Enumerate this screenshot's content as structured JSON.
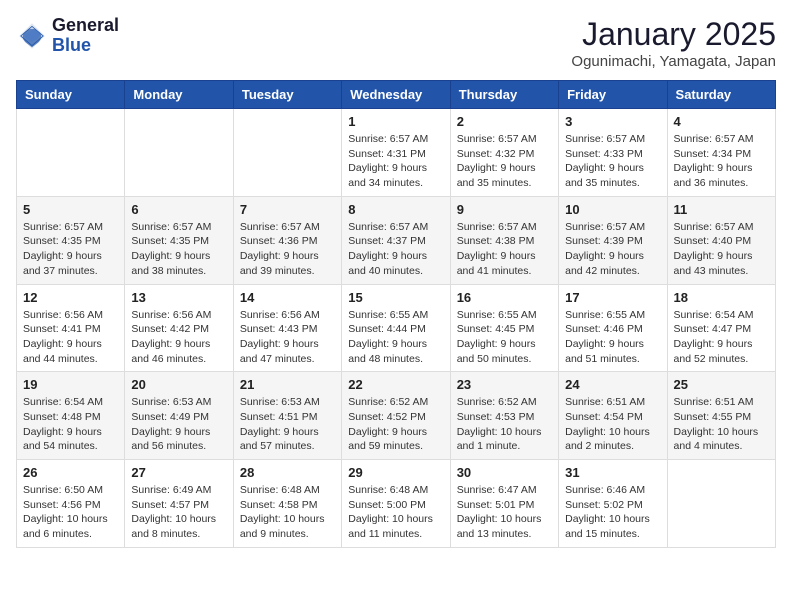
{
  "header": {
    "logo_general": "General",
    "logo_blue": "Blue",
    "month_title": "January 2025",
    "location": "Ogunimachi, Yamagata, Japan"
  },
  "weekdays": [
    "Sunday",
    "Monday",
    "Tuesday",
    "Wednesday",
    "Thursday",
    "Friday",
    "Saturday"
  ],
  "weeks": [
    [
      {
        "day": "",
        "sunrise": "",
        "sunset": "",
        "daylight": ""
      },
      {
        "day": "",
        "sunrise": "",
        "sunset": "",
        "daylight": ""
      },
      {
        "day": "",
        "sunrise": "",
        "sunset": "",
        "daylight": ""
      },
      {
        "day": "1",
        "sunrise": "Sunrise: 6:57 AM",
        "sunset": "Sunset: 4:31 PM",
        "daylight": "Daylight: 9 hours and 34 minutes."
      },
      {
        "day": "2",
        "sunrise": "Sunrise: 6:57 AM",
        "sunset": "Sunset: 4:32 PM",
        "daylight": "Daylight: 9 hours and 35 minutes."
      },
      {
        "day": "3",
        "sunrise": "Sunrise: 6:57 AM",
        "sunset": "Sunset: 4:33 PM",
        "daylight": "Daylight: 9 hours and 35 minutes."
      },
      {
        "day": "4",
        "sunrise": "Sunrise: 6:57 AM",
        "sunset": "Sunset: 4:34 PM",
        "daylight": "Daylight: 9 hours and 36 minutes."
      }
    ],
    [
      {
        "day": "5",
        "sunrise": "Sunrise: 6:57 AM",
        "sunset": "Sunset: 4:35 PM",
        "daylight": "Daylight: 9 hours and 37 minutes."
      },
      {
        "day": "6",
        "sunrise": "Sunrise: 6:57 AM",
        "sunset": "Sunset: 4:35 PM",
        "daylight": "Daylight: 9 hours and 38 minutes."
      },
      {
        "day": "7",
        "sunrise": "Sunrise: 6:57 AM",
        "sunset": "Sunset: 4:36 PM",
        "daylight": "Daylight: 9 hours and 39 minutes."
      },
      {
        "day": "8",
        "sunrise": "Sunrise: 6:57 AM",
        "sunset": "Sunset: 4:37 PM",
        "daylight": "Daylight: 9 hours and 40 minutes."
      },
      {
        "day": "9",
        "sunrise": "Sunrise: 6:57 AM",
        "sunset": "Sunset: 4:38 PM",
        "daylight": "Daylight: 9 hours and 41 minutes."
      },
      {
        "day": "10",
        "sunrise": "Sunrise: 6:57 AM",
        "sunset": "Sunset: 4:39 PM",
        "daylight": "Daylight: 9 hours and 42 minutes."
      },
      {
        "day": "11",
        "sunrise": "Sunrise: 6:57 AM",
        "sunset": "Sunset: 4:40 PM",
        "daylight": "Daylight: 9 hours and 43 minutes."
      }
    ],
    [
      {
        "day": "12",
        "sunrise": "Sunrise: 6:56 AM",
        "sunset": "Sunset: 4:41 PM",
        "daylight": "Daylight: 9 hours and 44 minutes."
      },
      {
        "day": "13",
        "sunrise": "Sunrise: 6:56 AM",
        "sunset": "Sunset: 4:42 PM",
        "daylight": "Daylight: 9 hours and 46 minutes."
      },
      {
        "day": "14",
        "sunrise": "Sunrise: 6:56 AM",
        "sunset": "Sunset: 4:43 PM",
        "daylight": "Daylight: 9 hours and 47 minutes."
      },
      {
        "day": "15",
        "sunrise": "Sunrise: 6:55 AM",
        "sunset": "Sunset: 4:44 PM",
        "daylight": "Daylight: 9 hours and 48 minutes."
      },
      {
        "day": "16",
        "sunrise": "Sunrise: 6:55 AM",
        "sunset": "Sunset: 4:45 PM",
        "daylight": "Daylight: 9 hours and 50 minutes."
      },
      {
        "day": "17",
        "sunrise": "Sunrise: 6:55 AM",
        "sunset": "Sunset: 4:46 PM",
        "daylight": "Daylight: 9 hours and 51 minutes."
      },
      {
        "day": "18",
        "sunrise": "Sunrise: 6:54 AM",
        "sunset": "Sunset: 4:47 PM",
        "daylight": "Daylight: 9 hours and 52 minutes."
      }
    ],
    [
      {
        "day": "19",
        "sunrise": "Sunrise: 6:54 AM",
        "sunset": "Sunset: 4:48 PM",
        "daylight": "Daylight: 9 hours and 54 minutes."
      },
      {
        "day": "20",
        "sunrise": "Sunrise: 6:53 AM",
        "sunset": "Sunset: 4:49 PM",
        "daylight": "Daylight: 9 hours and 56 minutes."
      },
      {
        "day": "21",
        "sunrise": "Sunrise: 6:53 AM",
        "sunset": "Sunset: 4:51 PM",
        "daylight": "Daylight: 9 hours and 57 minutes."
      },
      {
        "day": "22",
        "sunrise": "Sunrise: 6:52 AM",
        "sunset": "Sunset: 4:52 PM",
        "daylight": "Daylight: 9 hours and 59 minutes."
      },
      {
        "day": "23",
        "sunrise": "Sunrise: 6:52 AM",
        "sunset": "Sunset: 4:53 PM",
        "daylight": "Daylight: 10 hours and 1 minute."
      },
      {
        "day": "24",
        "sunrise": "Sunrise: 6:51 AM",
        "sunset": "Sunset: 4:54 PM",
        "daylight": "Daylight: 10 hours and 2 minutes."
      },
      {
        "day": "25",
        "sunrise": "Sunrise: 6:51 AM",
        "sunset": "Sunset: 4:55 PM",
        "daylight": "Daylight: 10 hours and 4 minutes."
      }
    ],
    [
      {
        "day": "26",
        "sunrise": "Sunrise: 6:50 AM",
        "sunset": "Sunset: 4:56 PM",
        "daylight": "Daylight: 10 hours and 6 minutes."
      },
      {
        "day": "27",
        "sunrise": "Sunrise: 6:49 AM",
        "sunset": "Sunset: 4:57 PM",
        "daylight": "Daylight: 10 hours and 8 minutes."
      },
      {
        "day": "28",
        "sunrise": "Sunrise: 6:48 AM",
        "sunset": "Sunset: 4:58 PM",
        "daylight": "Daylight: 10 hours and 9 minutes."
      },
      {
        "day": "29",
        "sunrise": "Sunrise: 6:48 AM",
        "sunset": "Sunset: 5:00 PM",
        "daylight": "Daylight: 10 hours and 11 minutes."
      },
      {
        "day": "30",
        "sunrise": "Sunrise: 6:47 AM",
        "sunset": "Sunset: 5:01 PM",
        "daylight": "Daylight: 10 hours and 13 minutes."
      },
      {
        "day": "31",
        "sunrise": "Sunrise: 6:46 AM",
        "sunset": "Sunset: 5:02 PM",
        "daylight": "Daylight: 10 hours and 15 minutes."
      },
      {
        "day": "",
        "sunrise": "",
        "sunset": "",
        "daylight": ""
      }
    ]
  ]
}
